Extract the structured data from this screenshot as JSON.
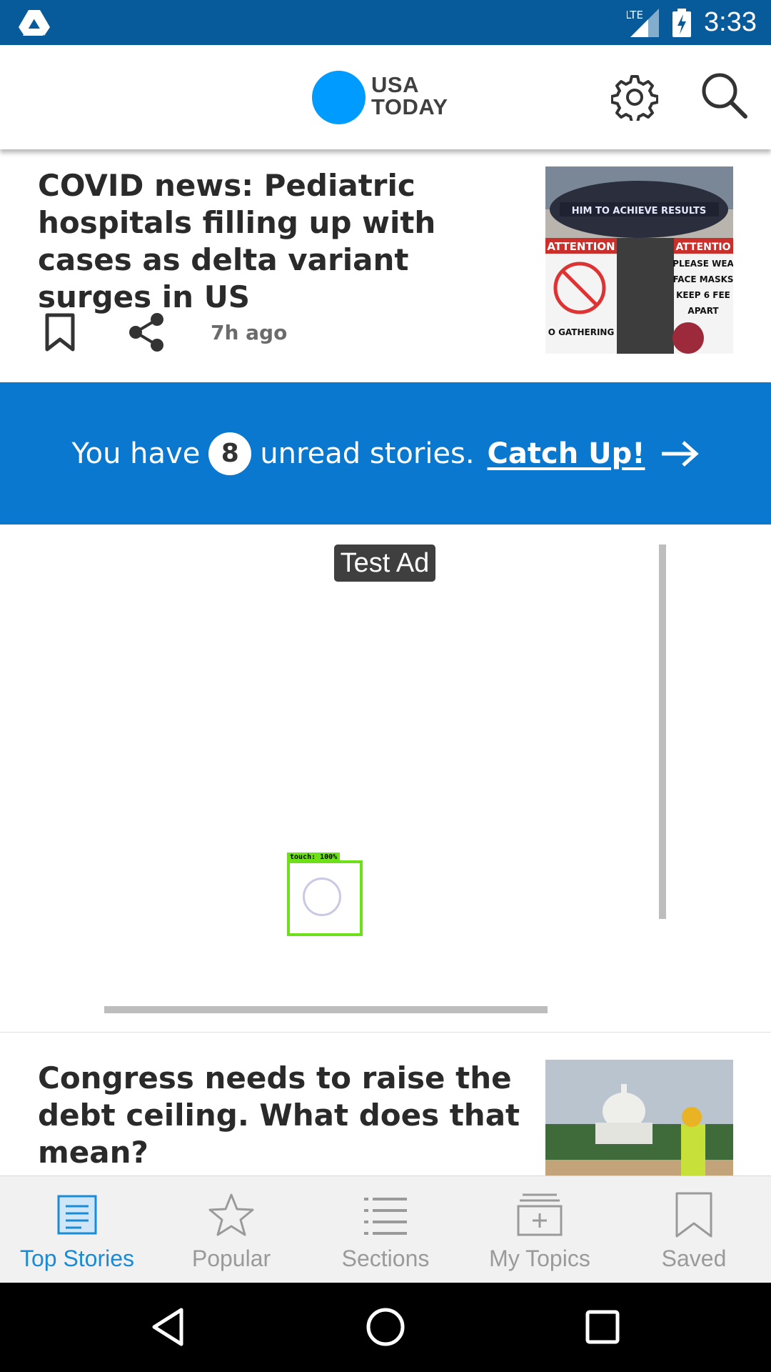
{
  "status_bar": {
    "network": "LTE",
    "time": "3:33",
    "icons": [
      "drive-icon",
      "signal-icon",
      "battery-charging-icon"
    ]
  },
  "header": {
    "logo_line1": "USA",
    "logo_line2": "TODAY",
    "icons": [
      "settings-gear-icon",
      "search-icon"
    ]
  },
  "stories": [
    {
      "headline": "COVID news: Pediatric hospitals filling up with cases as delta variant surges in US",
      "time": "7h ago",
      "image_alt": "Attention signs: please wear face masks, keep 6 feet apart, no gathering",
      "image_sign_top": "HIM TO ACHIEVE RESULTS",
      "image_sign_left": "ATTENTION",
      "image_sign_right_title": "ATTENTIO",
      "image_sign_right_lines": [
        "PLEASE WEA",
        "FACE MASKS",
        "KEEP 6 FEE",
        "APART"
      ],
      "image_sign_bottom": "O GATHERING"
    },
    {
      "headline": "Congress needs to raise the debt ceiling. What does that mean?",
      "image_alt": "Worker in safety vest near the U.S. Capitol"
    }
  ],
  "catchup": {
    "prefix": "You have",
    "count": "8",
    "suffix": "unread stories.",
    "link": "Catch Up!"
  },
  "ad": {
    "label": "Test Ad",
    "touch_overlay": "touch: 100%"
  },
  "bottom_nav": [
    {
      "label": "Top Stories",
      "icon": "news-article-icon",
      "active": true
    },
    {
      "label": "Popular",
      "icon": "star-icon",
      "active": false
    },
    {
      "label": "Sections",
      "icon": "list-icon",
      "active": false
    },
    {
      "label": "My Topics",
      "icon": "add-folder-icon",
      "active": false
    },
    {
      "label": "Saved",
      "icon": "bookmark-icon",
      "active": false
    }
  ],
  "colors": {
    "status_bar": "#075b9a",
    "brand_blue": "#009bff",
    "banner_blue": "#0b78d0",
    "active_nav": "#1a8bd6"
  }
}
